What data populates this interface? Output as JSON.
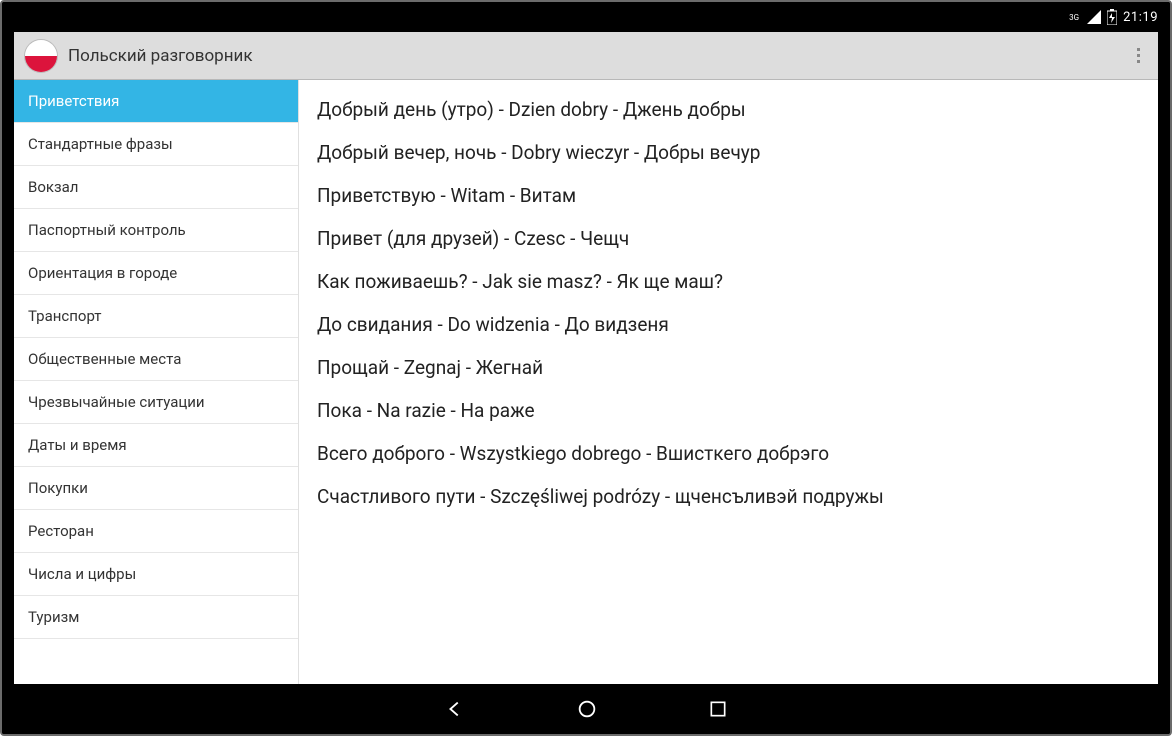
{
  "status": {
    "network": "3G",
    "clock": "21:19"
  },
  "header": {
    "title": "Польский разговорник"
  },
  "sidebar": {
    "items": [
      {
        "label": "Приветствия",
        "selected": true
      },
      {
        "label": "Стандартные фразы",
        "selected": false
      },
      {
        "label": "Вокзал",
        "selected": false
      },
      {
        "label": "Паспортный контроль",
        "selected": false
      },
      {
        "label": "Ориентация в городе",
        "selected": false
      },
      {
        "label": "Транспорт",
        "selected": false
      },
      {
        "label": "Общественные места",
        "selected": false
      },
      {
        "label": "Чрезвычайные ситуации",
        "selected": false
      },
      {
        "label": "Даты и время",
        "selected": false
      },
      {
        "label": "Покупки",
        "selected": false
      },
      {
        "label": "Ресторан",
        "selected": false
      },
      {
        "label": "Числа и цифры",
        "selected": false
      },
      {
        "label": "Туризм",
        "selected": false
      }
    ]
  },
  "phrases": [
    "Добрый день (утро) - Dzien dobry - Джень добры",
    "Добрый вечер, ночь - Dobry wieczyr - Добры вечур",
    "Приветствую - Witam - Витам",
    "Привет (для друзей) - Czesc - Чещч",
    "Как поживаешь? - Jak sie masz? - Як ще маш?",
    "До свидания - Do widzenia - До видзеня",
    "Прощай - Zegnaj - Жегнай",
    "Пока - Na razie - На раже",
    "Всего доброго - Wszystkiego dobrego - Вшисткего добрэго",
    "Счастливого пути - Szczęśliwej podrózy - щченсъливэй подружы"
  ]
}
